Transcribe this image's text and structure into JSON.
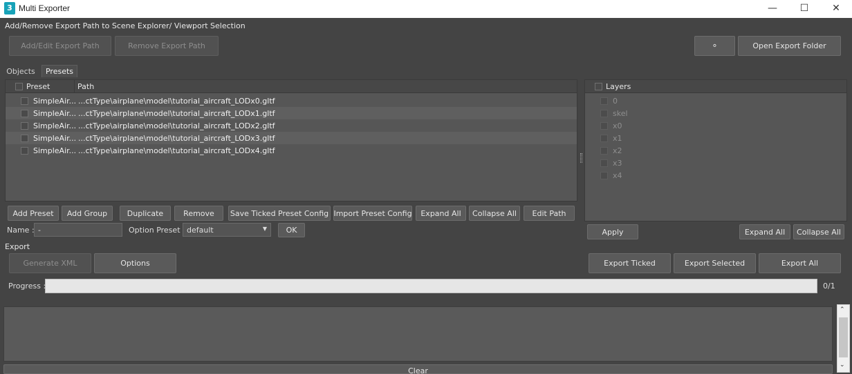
{
  "window": {
    "title": "Multi Exporter",
    "icon_label": "3"
  },
  "path_section": {
    "label": "Add/Remove Export Path to Scene Explorer/ Viewport Selection",
    "add_edit_label": "Add/Edit Export Path",
    "remove_label": "Remove Export Path",
    "refresh_glyph": "∘",
    "open_folder_label": "Open Export Folder"
  },
  "tabs": [
    {
      "label": "Objects"
    },
    {
      "label": "Presets"
    }
  ],
  "presets_table": {
    "col_preset": "Preset",
    "col_path": "Path",
    "rows": [
      {
        "preset": "SimpleAir...",
        "path": "...ctType\\airplane\\model\\tutorial_aircraft_LODx0.gltf"
      },
      {
        "preset": "SimpleAir...",
        "path": "...ctType\\airplane\\model\\tutorial_aircraft_LODx1.gltf"
      },
      {
        "preset": "SimpleAir...",
        "path": "...ctType\\airplane\\model\\tutorial_aircraft_LODx2.gltf"
      },
      {
        "preset": "SimpleAir...",
        "path": "...ctType\\airplane\\model\\tutorial_aircraft_LODx3.gltf"
      },
      {
        "preset": "SimpleAir...",
        "path": "...ctType\\airplane\\model\\tutorial_aircraft_LODx4.gltf"
      }
    ]
  },
  "preset_buttons": {
    "add_preset": "Add Preset",
    "add_group": "Add Group",
    "duplicate": "Duplicate",
    "remove": "Remove",
    "save_ticked": "Save Ticked Preset Config",
    "import_config": "Import Preset Config",
    "expand_all": "Expand All",
    "collapse_all": "Collapse All",
    "edit_path": "Edit Path"
  },
  "name_row": {
    "name_label": "Name :",
    "name_value": "-",
    "option_preset_label": "Option Preset :",
    "option_preset_value": "default",
    "ok_label": "OK"
  },
  "layers": {
    "header": "Layers",
    "items": [
      "0",
      "skel",
      "x0",
      "x1",
      "x2",
      "x3",
      "x4"
    ],
    "apply_label": "Apply",
    "expand_all": "Expand All",
    "collapse_all": "Collapse All"
  },
  "export_section": {
    "label": "Export",
    "generate_xml": "Generate XML",
    "options": "Options",
    "export_ticked": "Export Ticked",
    "export_selected": "Export Selected",
    "export_all": "Export All",
    "progress_label": "Progress :",
    "progress_count": "0/1",
    "progress_fraction": 0
  },
  "log": {
    "clear_label": "Clear"
  }
}
